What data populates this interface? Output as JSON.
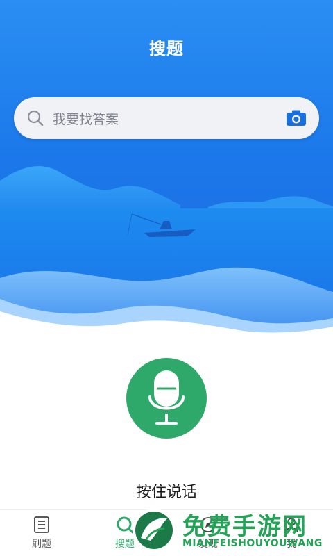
{
  "header": {
    "title": "搜题"
  },
  "search": {
    "placeholder": "我要找答案",
    "left_icon": "search-icon",
    "right_icon": "camera-icon"
  },
  "voice": {
    "label": "按住说话",
    "icon": "microphone-icon"
  },
  "tabs": [
    {
      "label": "刷题",
      "icon": "list-icon"
    },
    {
      "label": "搜题",
      "icon": "search-tab-icon"
    },
    {
      "label": "发现",
      "icon": "discover-icon"
    },
    {
      "label": "我",
      "icon": "profile-icon"
    }
  ],
  "watermark": {
    "title": "免费手游网",
    "subtitle": "MIANFEISHOUYOUWANG"
  },
  "colors": {
    "primary": "#1c79ea",
    "accent_green": "#2ea96a",
    "watermark_green": "#23a356"
  }
}
